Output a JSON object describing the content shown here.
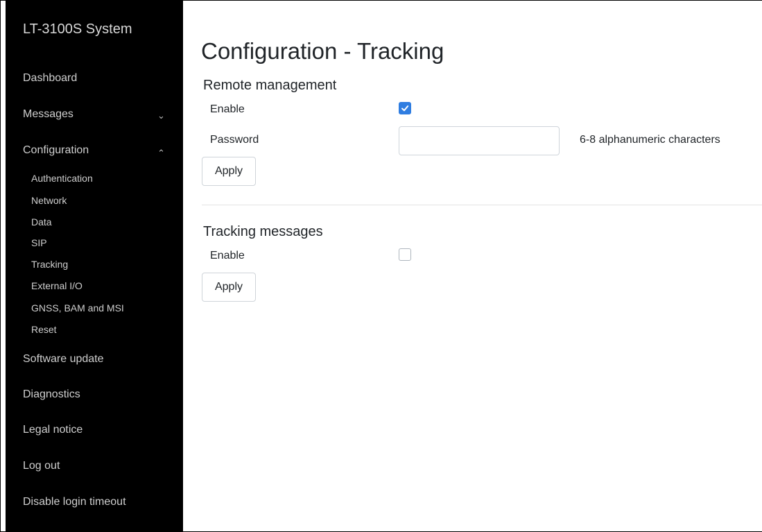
{
  "sidebar": {
    "brand": "LT-3100S System",
    "items": {
      "dashboard": "Dashboard",
      "messages": "Messages",
      "configuration": "Configuration",
      "software_update": "Software update",
      "diagnostics": "Diagnostics",
      "legal_notice": "Legal notice",
      "log_out": "Log out",
      "disable_login_timeout": "Disable login timeout"
    },
    "chevrons": {
      "messages": "⌄",
      "configuration": "⌃"
    },
    "config_subitems": {
      "authentication": "Authentication",
      "network": "Network",
      "data": "Data",
      "sip": "SIP",
      "tracking": "Tracking",
      "external_io": "External I/O",
      "gnss_bam_msi": "GNSS, BAM and MSI",
      "reset": "Reset"
    }
  },
  "main": {
    "title": "Configuration - Tracking",
    "remote_management": {
      "heading": "Remote management",
      "enable_label": "Enable",
      "enable_checked": true,
      "password_label": "Password",
      "password_value": "",
      "password_hint": "6-8 alphanumeric characters",
      "apply_label": "Apply"
    },
    "tracking_messages": {
      "heading": "Tracking messages",
      "enable_label": "Enable",
      "enable_checked": false,
      "apply_label": "Apply"
    }
  },
  "colors": {
    "sidebar_bg": "#000000",
    "accent": "#2f7de1"
  }
}
